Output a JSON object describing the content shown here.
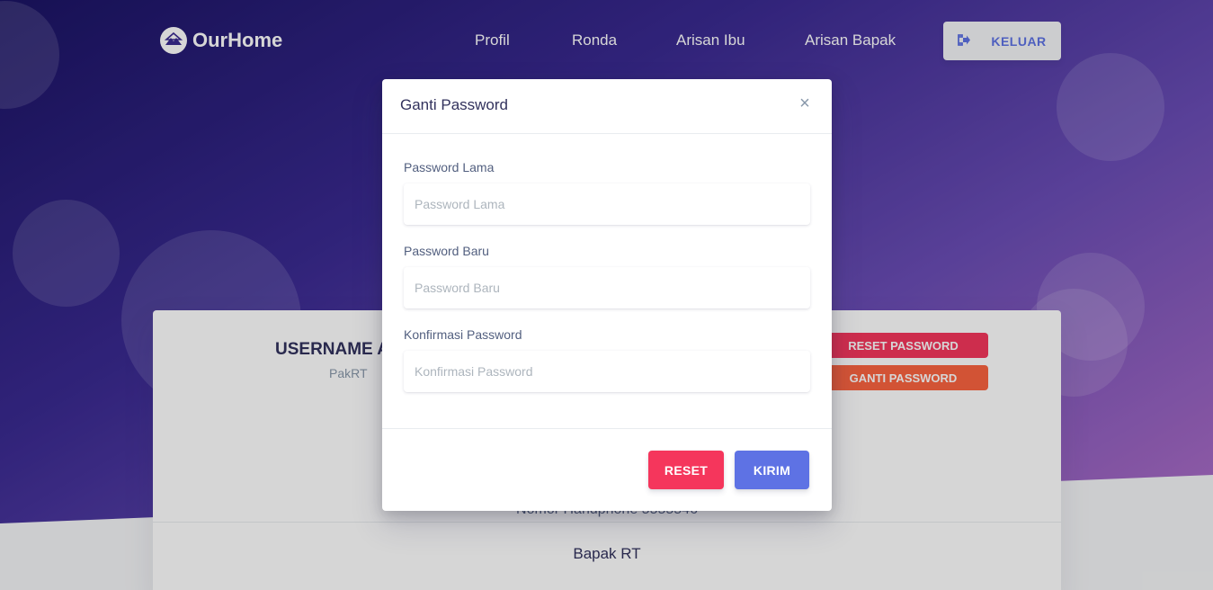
{
  "navbar": {
    "brand": "OurHome",
    "links": [
      "Profil",
      "Ronda",
      "Arisan Ibu",
      "Arisan Bapak"
    ],
    "logout_label": "KELUAR"
  },
  "profile_card": {
    "username_heading": "USERNAME A",
    "login_name": "PakRT",
    "reset_password_label": "RESET PASSWORD",
    "change_password_label": "GANTI PASSWORD",
    "phone_text": "Nomor Handphone 5555546",
    "role": "Bapak RT"
  },
  "modal": {
    "title": "Ganti Password",
    "close_symbol": "×",
    "fields": [
      {
        "label": "Password Lama",
        "placeholder": "Password Lama",
        "value": ""
      },
      {
        "label": "Password Baru",
        "placeholder": "Password Baru",
        "value": ""
      },
      {
        "label": "Konfirmasi Password",
        "placeholder": "Konfirmasi Password",
        "value": ""
      }
    ],
    "reset_label": "RESET",
    "submit_label": "KIRIM"
  },
  "colors": {
    "primary": "#5e72e4",
    "danger": "#f5365c",
    "warning": "#fb6340",
    "text_dark": "#32325d"
  },
  "icons": {
    "brand": "home-logo-icon",
    "logout": "sign-out-icon"
  }
}
